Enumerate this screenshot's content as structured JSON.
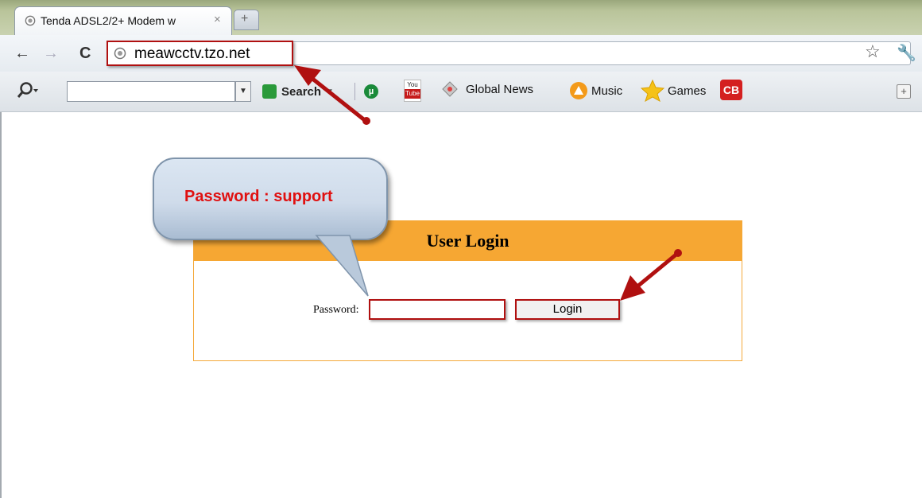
{
  "browser": {
    "tab_title": "Tenda ADSL2/2+ Modem w",
    "tab_close": "×",
    "new_tab": "+",
    "url": "meawcctv.tzo.net"
  },
  "toolbar": {
    "search_label": "Search",
    "items": [
      "Global News",
      "Music",
      "Games"
    ],
    "cb_label": "CB",
    "youtube_top": "You",
    "youtube_bottom": "Tube"
  },
  "login": {
    "title": "User Login",
    "password_label": "Password:",
    "password_value": "",
    "login_button": "Login"
  },
  "callout": {
    "text": "Password : support"
  },
  "colors": {
    "header_orange": "#f6a733",
    "highlight_red": "#b01010",
    "callout_text": "#e01010"
  }
}
